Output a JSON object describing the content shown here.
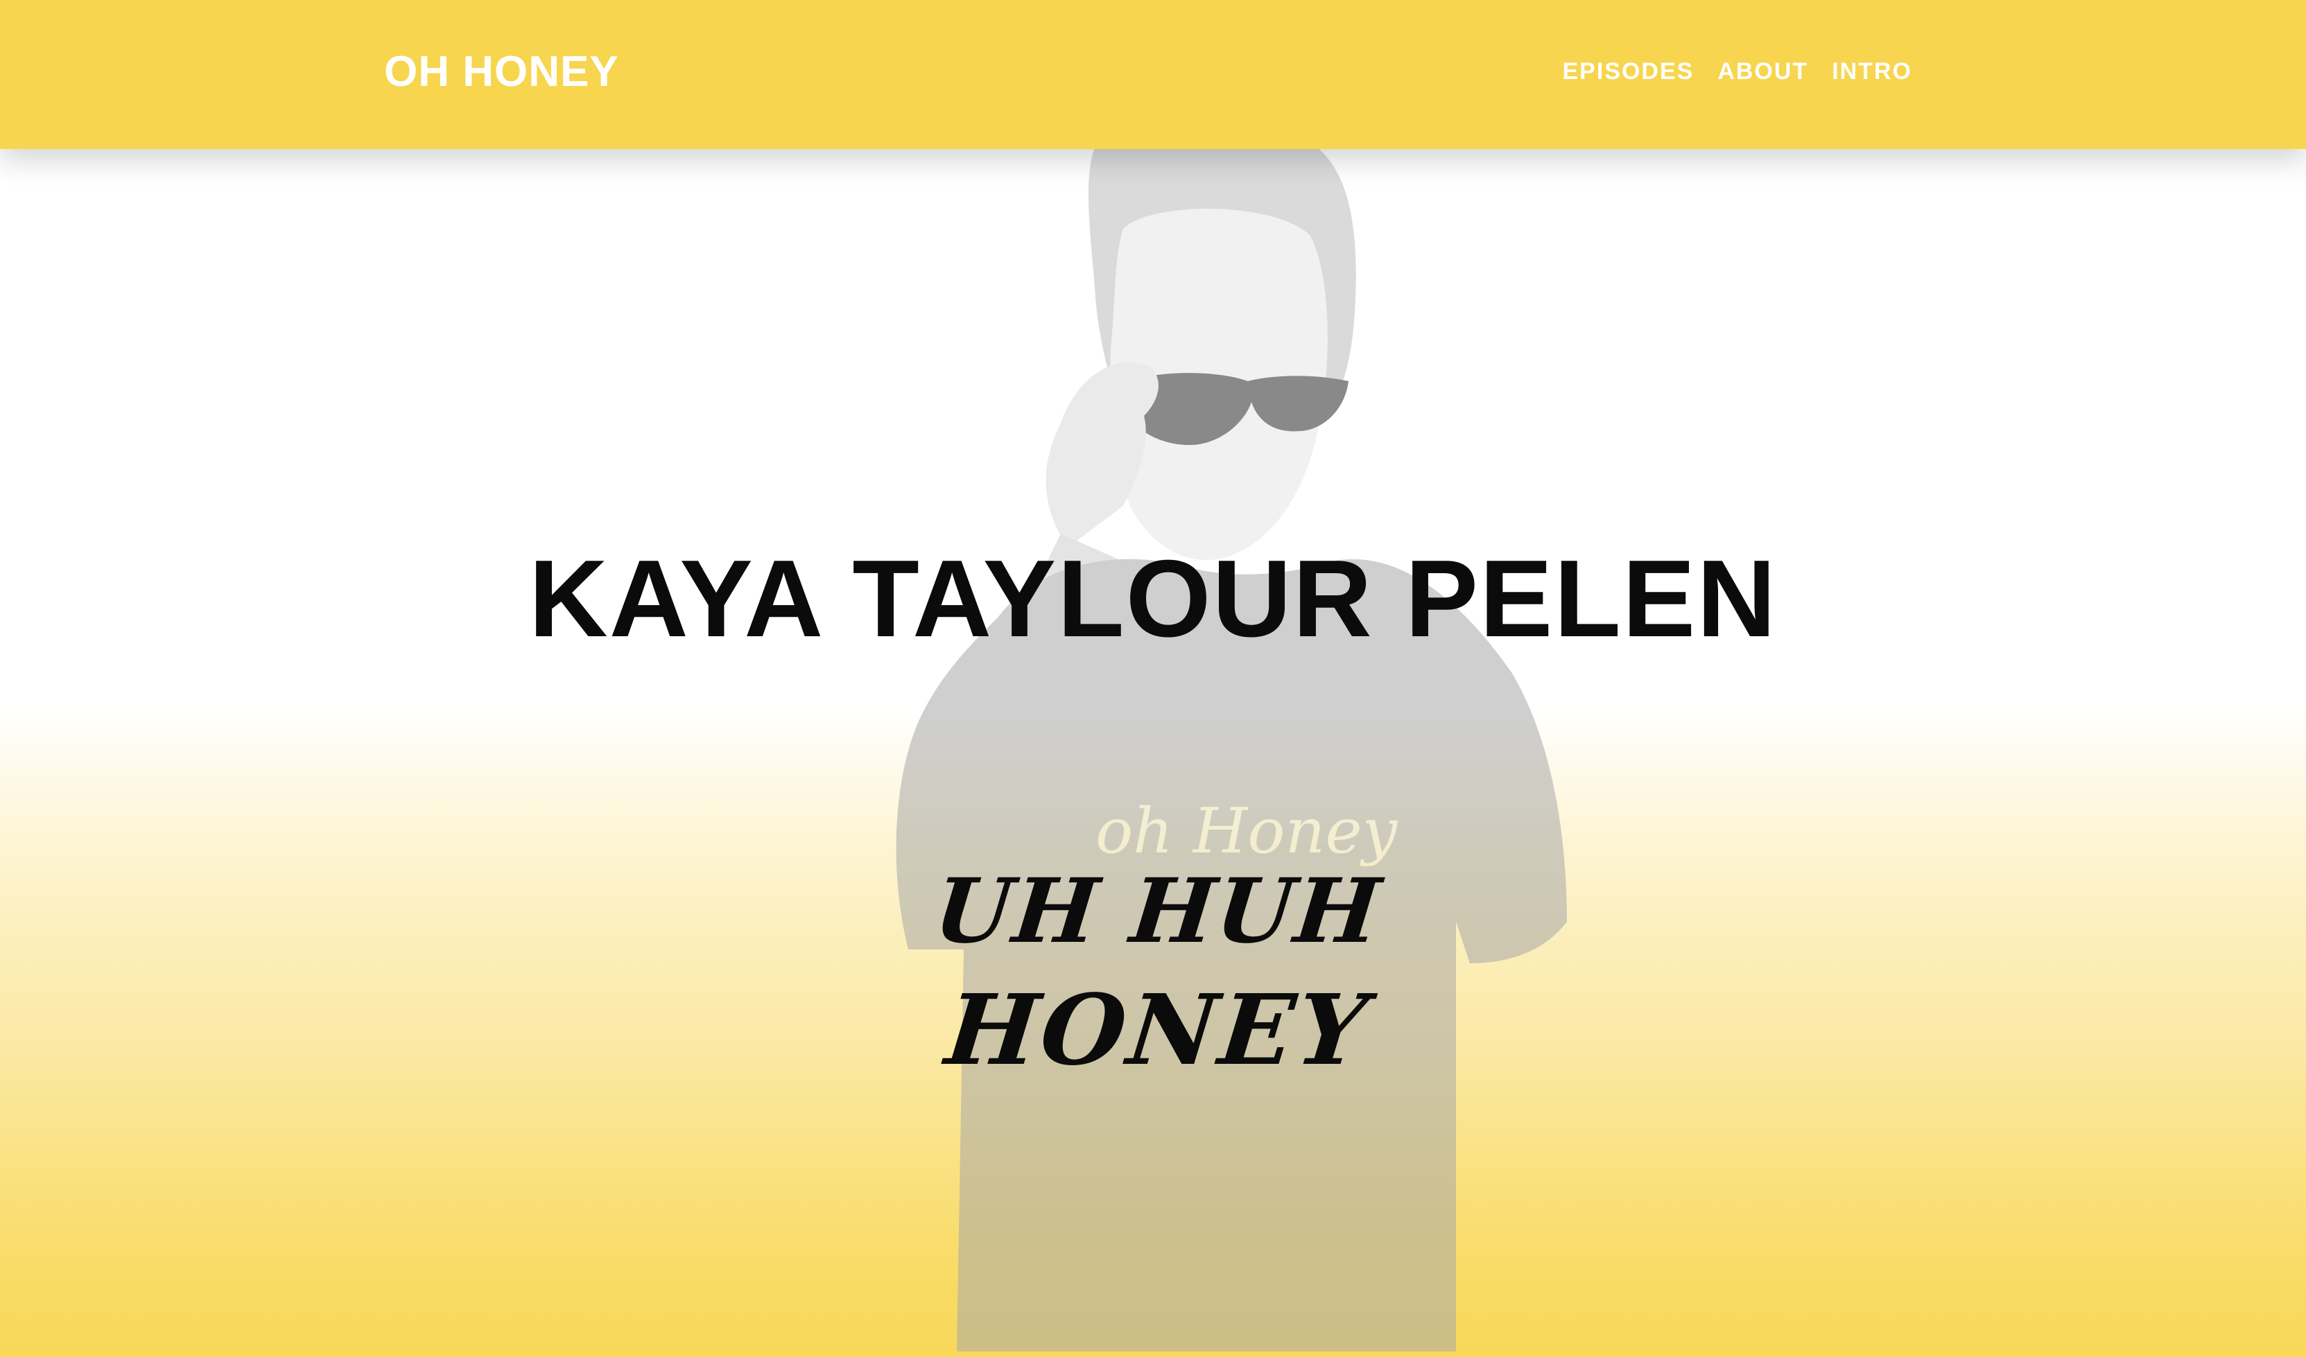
{
  "nav": {
    "brand": "OH HONEY",
    "links": [
      "EPISODES",
      "ABOUT",
      "INTRO"
    ]
  },
  "hero": {
    "title": "KAYA TAYLOUR PELEN",
    "logo_line_1": "UH HUH",
    "logo_line_2": "HONEY",
    "shirt_text": "oh Honey",
    "image": "portrait-photo"
  },
  "colors": {
    "accent": "#f8d54e",
    "text": "#0b0b0b",
    "nav_text": "#ffffff"
  }
}
